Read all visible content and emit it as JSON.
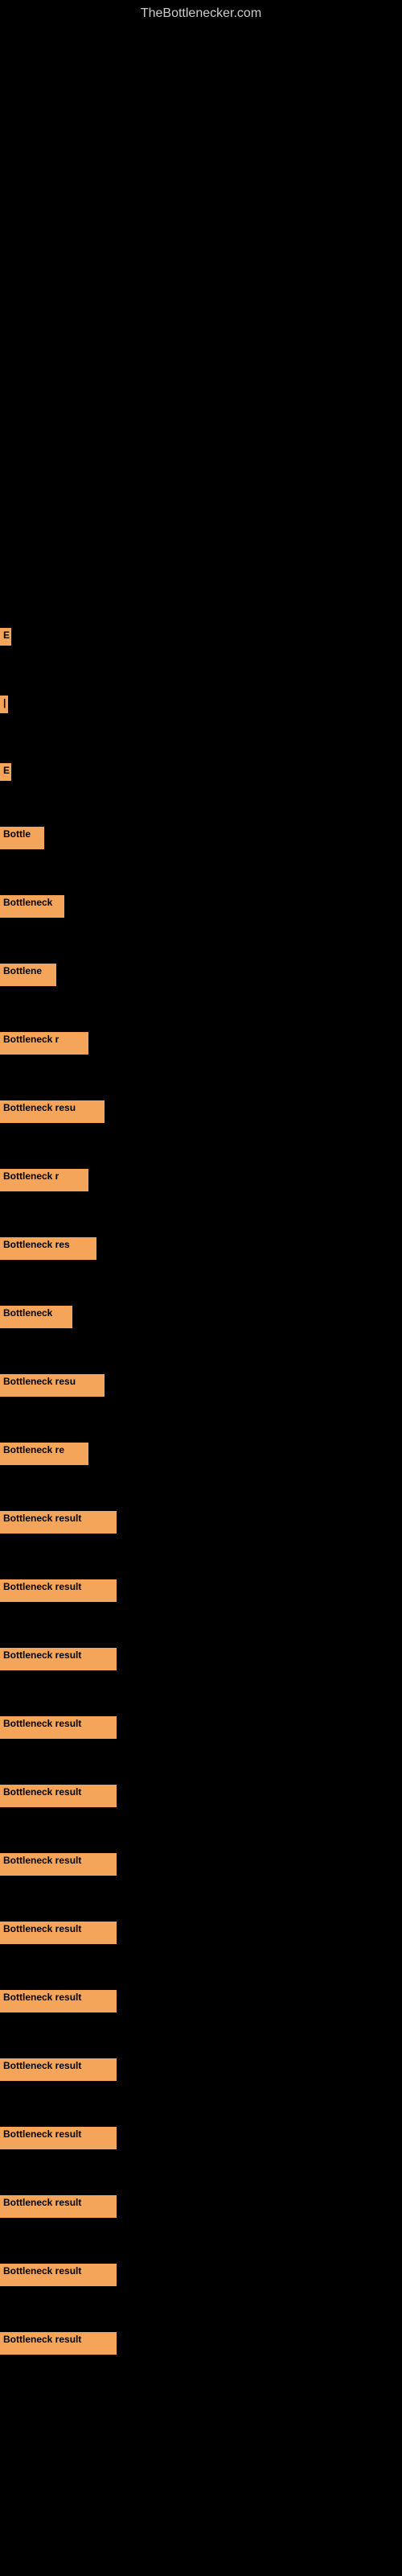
{
  "site": {
    "title": "TheBottlenecker.com"
  },
  "labels": [
    {
      "id": 1,
      "text": "E",
      "class": "label-1"
    },
    {
      "id": 2,
      "text": "|",
      "class": "label-2"
    },
    {
      "id": 3,
      "text": "E",
      "class": "label-3"
    },
    {
      "id": 4,
      "text": "Bottle",
      "class": "label-4"
    },
    {
      "id": 5,
      "text": "Bottleneck",
      "class": "label-5"
    },
    {
      "id": 6,
      "text": "Bottlene",
      "class": "label-6"
    },
    {
      "id": 7,
      "text": "Bottleneck r",
      "class": "label-7"
    },
    {
      "id": 8,
      "text": "Bottleneck resu",
      "class": "label-8"
    },
    {
      "id": 9,
      "text": "Bottleneck r",
      "class": "label-9"
    },
    {
      "id": 10,
      "text": "Bottleneck res",
      "class": "label-10"
    },
    {
      "id": 11,
      "text": "Bottleneck",
      "class": "label-11"
    },
    {
      "id": 12,
      "text": "Bottleneck resu",
      "class": "label-12"
    },
    {
      "id": 13,
      "text": "Bottleneck re",
      "class": "label-13"
    },
    {
      "id": 14,
      "text": "Bottleneck result",
      "class": "label-14"
    },
    {
      "id": 15,
      "text": "Bottleneck result",
      "class": "label-15"
    },
    {
      "id": 16,
      "text": "Bottleneck result",
      "class": "label-16"
    },
    {
      "id": 17,
      "text": "Bottleneck result",
      "class": "label-17"
    },
    {
      "id": 18,
      "text": "Bottleneck result",
      "class": "label-18"
    },
    {
      "id": 19,
      "text": "Bottleneck result",
      "class": "label-19"
    },
    {
      "id": 20,
      "text": "Bottleneck result",
      "class": "label-20"
    },
    {
      "id": 21,
      "text": "Bottleneck result",
      "class": "label-21"
    },
    {
      "id": 22,
      "text": "Bottleneck result",
      "class": "label-22"
    },
    {
      "id": 23,
      "text": "Bottleneck result",
      "class": "label-23"
    },
    {
      "id": 24,
      "text": "Bottleneck result",
      "class": "label-24"
    },
    {
      "id": 25,
      "text": "Bottleneck result",
      "class": "label-25"
    },
    {
      "id": 26,
      "text": "Bottleneck result",
      "class": "label-26"
    }
  ]
}
